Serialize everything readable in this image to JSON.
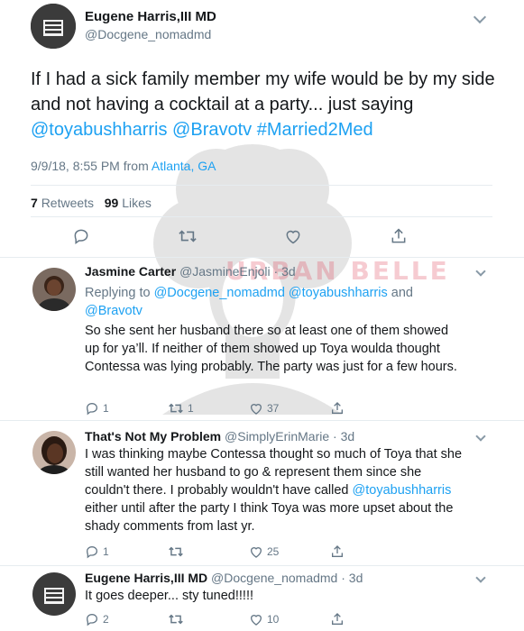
{
  "main_tweet": {
    "author_name": "Eugene Harris,III MD",
    "author_handle": "@Docgene_nomadmd",
    "text_plain": "If I had a sick family member my wife would be by my side and not having a cocktail at a party... just saying",
    "mentions": [
      "@toyabushharris",
      "@Bravotv",
      "#Married2Med"
    ],
    "timestamp": "9/9/18, 8:55 PM from",
    "location": "Atlanta, GA",
    "retweets_count": "7",
    "retweets_label": "Retweets",
    "likes_count": "99",
    "likes_label": "Likes"
  },
  "watermark": {
    "text": "URBAN BELLE"
  },
  "replies": [
    {
      "author_name": "Jasmine Carter",
      "author_handle": "@JasmineEnjoli · 3d",
      "replying_prefix": "Replying to",
      "replying_to": "@Docgene_nomadmd @toyabushharris",
      "replying_and": "and",
      "replying_last": "@Bravotv",
      "text": "So she sent her husband there so at least one of them showed up for ya’ll. If neither of them showed up Toya woulda thought Contessa was lying probably. The party was just for a few hours.",
      "reply_count": "1",
      "retweet_count": "1",
      "like_count": "37"
    },
    {
      "author_name": "That's Not My Problem",
      "author_handle": "@SimplyErinMarie · 3d",
      "text_before": "I was thinking maybe Contessa thought so much of Toya that she still wanted her husband to go & represent them since she couldn't there. I probably wouldn't have called",
      "text_mention": "@toyabushharris",
      "text_after": "either until after the party I think Toya was more upset about the shady comments from last yr.",
      "reply_count": "1",
      "retweet_count": "",
      "like_count": "25"
    },
    {
      "author_name": "Eugene Harris,III MD",
      "author_handle": "@Docgene_nomadmd · 3d",
      "text": "It goes deeper... sty tuned!!!!!",
      "reply_count": "2",
      "retweet_count": "",
      "like_count": "10"
    }
  ],
  "colors": {
    "link": "#1da1f2",
    "secondary_text": "#657786",
    "primary_text": "#14171a",
    "divider": "#e6ecf0",
    "watermark": "#e0465a"
  },
  "icons": [
    "reply-icon",
    "retweet-icon",
    "like-icon",
    "share-icon",
    "chevron-down-icon"
  ]
}
